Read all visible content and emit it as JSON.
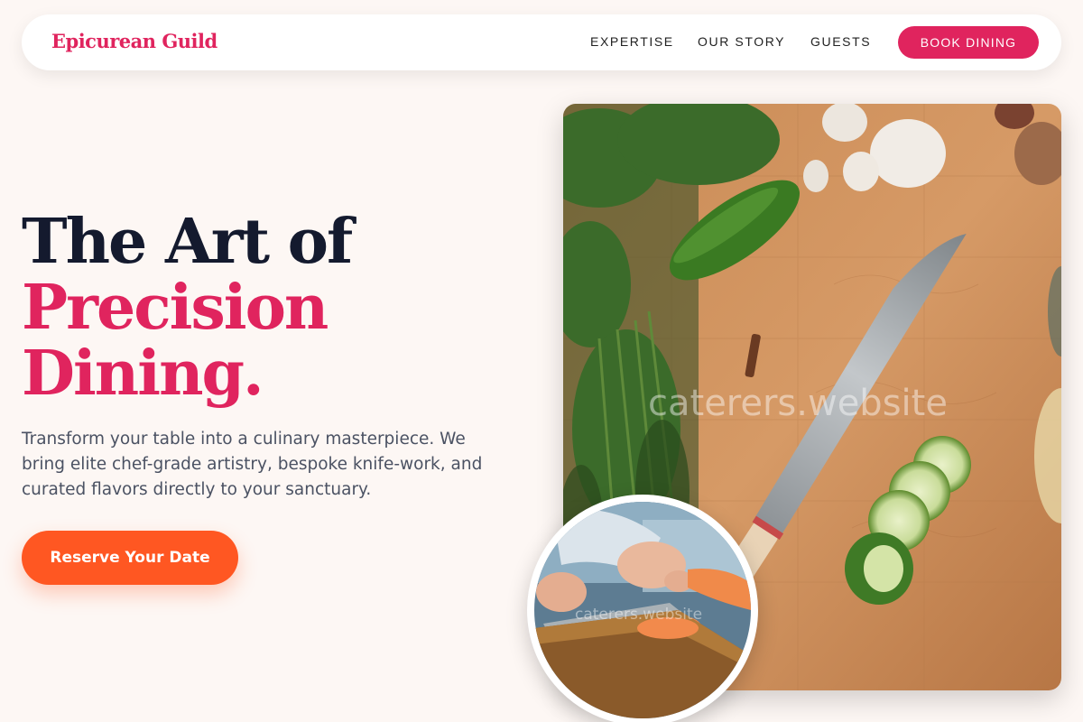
{
  "nav": {
    "brand": "Epicurean Guild",
    "links": [
      "EXPERTISE",
      "OUR STORY",
      "GUESTS"
    ],
    "cta": "BOOK DINING"
  },
  "hero": {
    "title_line1": "The Art of",
    "title_line2": "Precision",
    "title_line3": "Dining.",
    "description": "Transform your table into a culinary masterpiece. We bring elite chef-grade artistry, bespoke knife-work, and curated flavors directly to your sanctuary.",
    "cta": "Reserve Your Date"
  },
  "images": {
    "main_watermark": "caterers.website",
    "circle_watermark": "caterers.website"
  },
  "colors": {
    "accent_pink": "#e0245e",
    "accent_orange": "#ff5722",
    "background": "#fdf7f4",
    "heading_dark": "#141a2e"
  }
}
